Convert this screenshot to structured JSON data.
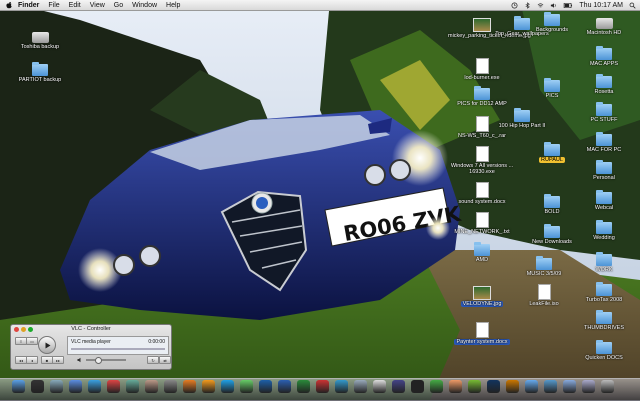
{
  "menubar": {
    "app_name": "Finder",
    "menus": [
      "File",
      "Edit",
      "View",
      "Go",
      "Window",
      "Help"
    ],
    "clock": "Thu 10:17 AM"
  },
  "wallpaper": {
    "plate": "RO06 ZVK",
    "colors": {
      "car": "#1c2a78",
      "sky": "#cfd8e6"
    }
  },
  "desktop_items": [
    {
      "label": "Toshiba backup",
      "kind": "drive"
    },
    {
      "label": "PARTIOT backup",
      "kind": "folder"
    },
    {
      "label": "mickey_parking_ticket_hdemo.jpg",
      "kind": "image"
    },
    {
      "label": "Top_Gear_wallpapers",
      "kind": "folder"
    },
    {
      "label": "Macintosh HD",
      "kind": "drive"
    },
    {
      "label": "Backgrounds",
      "kind": "folder"
    },
    {
      "label": "MAC APPS",
      "kind": "folder"
    },
    {
      "label": "lod-burner.exe",
      "kind": "doc"
    },
    {
      "label": "PICS",
      "kind": "folder"
    },
    {
      "label": "Rosetta",
      "kind": "folder"
    },
    {
      "label": "PICS for DD12 AMP",
      "kind": "folder"
    },
    {
      "label": "100 Hip Hop Part II",
      "kind": "folder"
    },
    {
      "label": "PC STUFF",
      "kind": "folder"
    },
    {
      "label": "NS-WS_T60_c_.rar",
      "kind": "doc"
    },
    {
      "label": "Windows 7 All versions ... 16930.exe",
      "kind": "doc"
    },
    {
      "label": "MAC FOR PC",
      "kind": "folder"
    },
    {
      "label": "RUPAUL",
      "kind": "folder"
    },
    {
      "label": "Personal",
      "kind": "folder"
    },
    {
      "label": "sound system.docx",
      "kind": "doc"
    },
    {
      "label": "BOLD",
      "kind": "folder"
    },
    {
      "label": "Webcal",
      "kind": "folder"
    },
    {
      "label": "MINE_NETWORK_.txt",
      "kind": "doc"
    },
    {
      "label": "New Downloads",
      "kind": "folder"
    },
    {
      "label": "Wedding",
      "kind": "folder"
    },
    {
      "label": "AMD",
      "kind": "folder"
    },
    {
      "label": "MUSIC 3/5/09",
      "kind": "folder"
    },
    {
      "label": "WORK",
      "kind": "folder"
    },
    {
      "label": "LeakFile.iso",
      "kind": "doc"
    },
    {
      "label": "TurboTax 2008",
      "kind": "folder"
    },
    {
      "label": "VELODYNE.jpg",
      "kind": "image"
    },
    {
      "label": "THUMBDRIVES",
      "kind": "folder"
    },
    {
      "label": "Paynter system.docx",
      "kind": "doc"
    },
    {
      "label": "Quicken DOCS",
      "kind": "folder"
    }
  ],
  "vlc": {
    "title": "VLC - Controller",
    "media": "VLC media player",
    "time": "0:00:00"
  },
  "dock": {
    "apps": [
      "finder",
      "dashboard",
      "itunes",
      "mail",
      "safari",
      "ical",
      "iphoto",
      "address-book",
      "system-preferences",
      "firefox",
      "vlc",
      "skype",
      "adium",
      "photoshop",
      "word",
      "excel",
      "calendar",
      "messenger",
      "preview",
      "textedit",
      "quicktime",
      "terminal",
      "activity",
      "office",
      "utorrent",
      "photoshop-cs",
      "illustrator",
      "network",
      "downloads",
      "documents",
      "applications",
      "trash"
    ]
  }
}
